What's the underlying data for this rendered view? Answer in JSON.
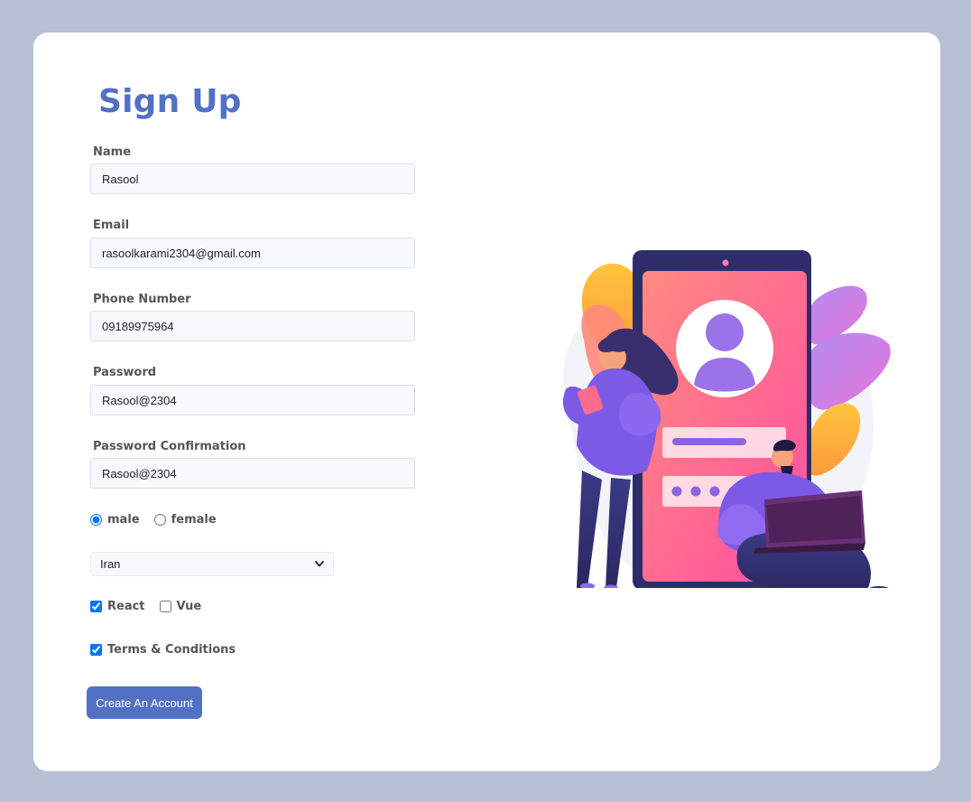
{
  "form": {
    "title": "Sign Up",
    "fields": [
      {
        "label": "Name",
        "value": "Rasool"
      },
      {
        "label": "Email",
        "value": "rasoolkarami2304@gmail.com"
      },
      {
        "label": "Phone Number",
        "value": "09189975964"
      },
      {
        "label": "Password",
        "value": "Rasool@2304"
      },
      {
        "label": "Password Confirmation",
        "value": "Rasool@2304"
      }
    ],
    "gender": {
      "options": [
        {
          "label": "male",
          "checked": true
        },
        {
          "label": "female",
          "checked": false
        }
      ]
    },
    "country": {
      "selected": "Iran"
    },
    "frameworks": [
      {
        "label": "React",
        "checked": true
      },
      {
        "label": "Vue",
        "checked": false
      }
    ],
    "terms": {
      "label": "Terms & Conditions",
      "checked": true
    },
    "submit_label": "Create An Account"
  },
  "colors": {
    "page_background": "#b7c0d4",
    "card_background": "#ffffff",
    "accent": "#5271c4",
    "label_text": "#555555",
    "input_background": "#f8f9fd"
  },
  "icons": {
    "select_arrow": "chevron-down-icon",
    "illustration": "signup-illustration"
  }
}
